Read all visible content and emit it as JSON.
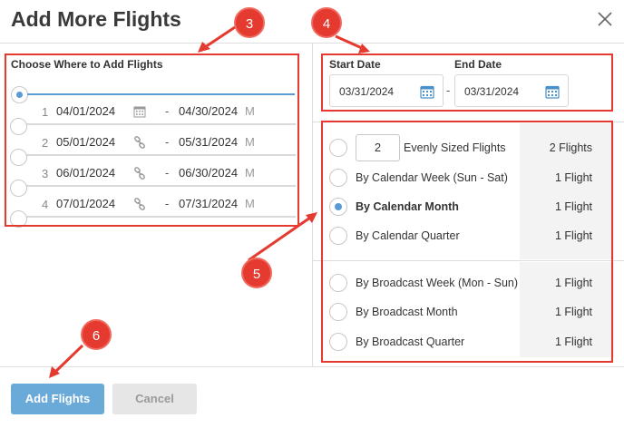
{
  "dialog": {
    "title": "Add More Flights",
    "close_icon": "close-icon"
  },
  "left": {
    "section_label": "Choose Where to Add Flights",
    "flights": [
      {
        "num": "1",
        "start": "04/01/2024",
        "icon": "calendar-icon",
        "end": "04/30/2024",
        "unit": "M"
      },
      {
        "num": "2",
        "start": "05/01/2024",
        "icon": "link-icon",
        "end": "05/31/2024",
        "unit": "M"
      },
      {
        "num": "3",
        "start": "06/01/2024",
        "icon": "link-icon",
        "end": "06/30/2024",
        "unit": "M"
      },
      {
        "num": "4",
        "start": "07/01/2024",
        "icon": "link-icon",
        "end": "07/31/2024",
        "unit": "M"
      }
    ]
  },
  "dates": {
    "start_label": "Start Date",
    "start_value": "03/31/2024",
    "separator": "-",
    "end_label": "End Date",
    "end_value": "03/31/2024"
  },
  "split_options": {
    "evenly_count": "2",
    "group1": [
      {
        "label": "Evenly Sized Flights",
        "count": "2 Flights",
        "selected": false
      },
      {
        "label": "By Calendar Week (Sun - Sat)",
        "count": "1 Flight",
        "selected": false
      },
      {
        "label": "By Calendar Month",
        "count": "1 Flight",
        "selected": true
      },
      {
        "label": "By Calendar Quarter",
        "count": "1 Flight",
        "selected": false
      }
    ],
    "group2": [
      {
        "label": "By Broadcast Week (Mon - Sun)",
        "count": "1 Flight",
        "selected": false
      },
      {
        "label": "By Broadcast Month",
        "count": "1 Flight",
        "selected": false
      },
      {
        "label": "By Broadcast Quarter",
        "count": "1 Flight",
        "selected": false
      }
    ]
  },
  "footer": {
    "add_label": "Add Flights",
    "cancel_label": "Cancel"
  },
  "annotations": {
    "badge3": "3",
    "badge4": "4",
    "badge5": "5",
    "badge6": "6",
    "color": "#e53a2f"
  },
  "colors": {
    "accent": "#5a9bd5",
    "primary_button": "#6aaad8"
  }
}
